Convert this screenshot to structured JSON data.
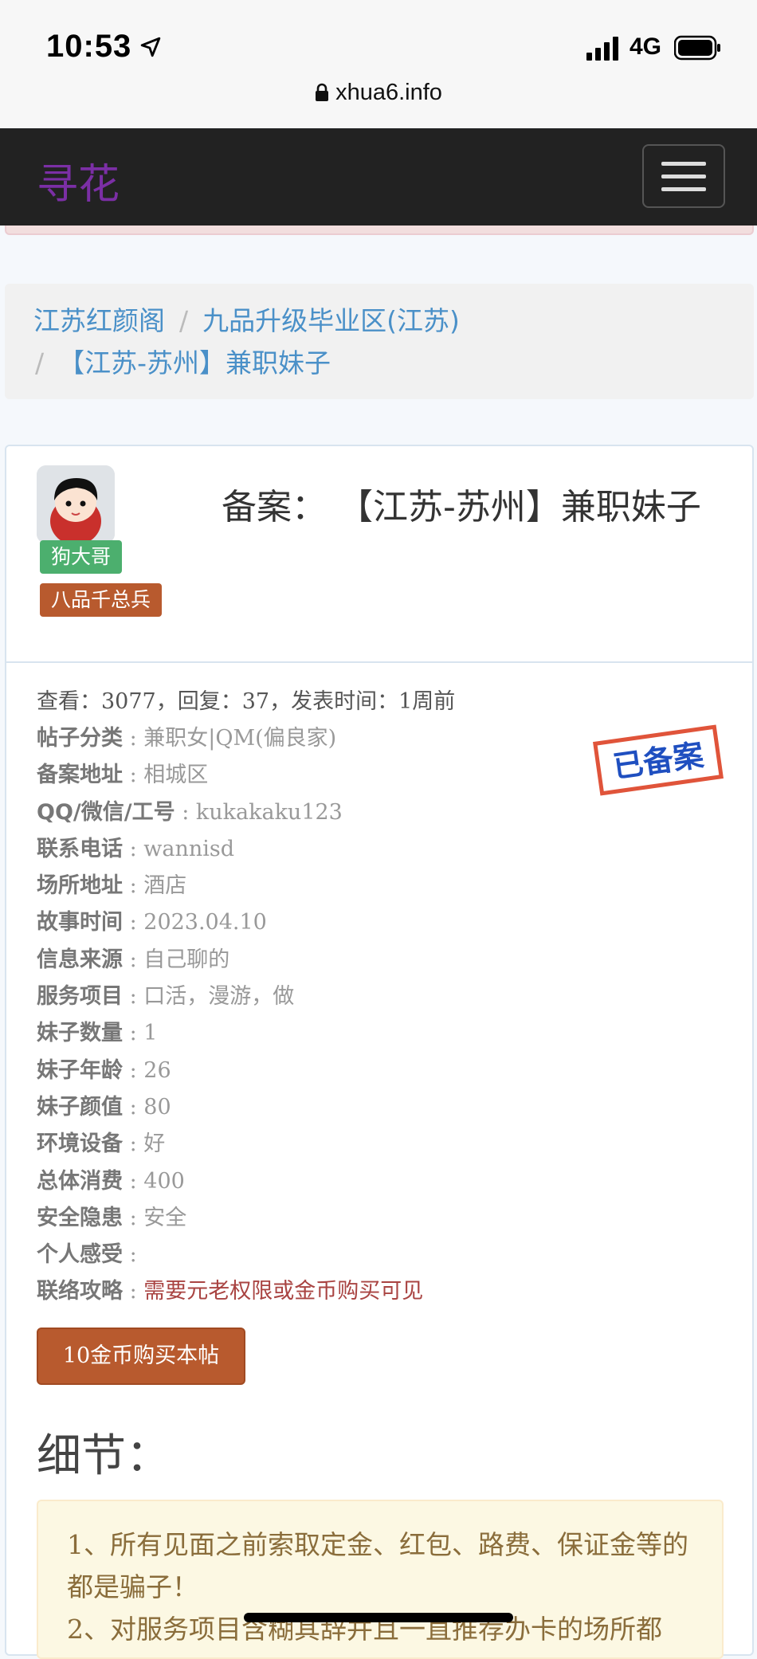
{
  "status_bar": {
    "time": "10:53",
    "network": "4G"
  },
  "browser": {
    "url": "xhua6.info"
  },
  "navbar": {
    "brand": "寻花"
  },
  "breadcrumb": [
    {
      "label": "江苏红颜阁"
    },
    {
      "label": "九品升级毕业区(江苏)"
    },
    {
      "label": "【江苏-苏州】兼职妹子"
    }
  ],
  "post": {
    "title": "备案：  【江苏-苏州】兼职妹子",
    "author": {
      "name": "狗大哥",
      "rank": "八品千总兵"
    },
    "stats": "查看：3077，回复：37，发表时间：1周前",
    "stamp": "已备案",
    "fields": [
      {
        "key": "帖子分类",
        "sep": " : ",
        "value": "兼职女|QM(偏良家)"
      },
      {
        "key": "备案地址",
        "sep": " : ",
        "value": "相城区"
      },
      {
        "key": "QQ/微信/工号",
        "sep": " : ",
        "value": "kukakaku123"
      },
      {
        "key": "联系电话",
        "sep": " : ",
        "value": "wannisd"
      },
      {
        "key": "场所地址",
        "sep": " : ",
        "value": "酒店"
      },
      {
        "key": "故事时间",
        "sep": " : ",
        "value": "2023.04.10"
      },
      {
        "key": "信息来源",
        "sep": " : ",
        "value": "自己聊的"
      },
      {
        "key": "服务项目",
        "sep": " : ",
        "value": "口活，漫游，做"
      },
      {
        "key": "妹子数量",
        "sep": " : ",
        "value": "1"
      },
      {
        "key": "妹子年龄",
        "sep": " : ",
        "value": "26"
      },
      {
        "key": "妹子颜值",
        "sep": " : ",
        "value": "80"
      },
      {
        "key": "环境设备",
        "sep": " : ",
        "value": "好"
      },
      {
        "key": "总体消费",
        "sep": " : ",
        "value": "400"
      },
      {
        "key": "安全隐患",
        "sep": " : ",
        "value": "安全"
      },
      {
        "key": "个人感受",
        "sep": " : ",
        "value": ""
      },
      {
        "key": "联络攻略",
        "sep": " : ",
        "value": "需要元老权限或金币购买可见"
      }
    ],
    "buy_button": "10金币购买本帖",
    "detail_heading": "细节：",
    "notice_lines": [
      "1、所有见面之前索取定金、红包、路费、保证金等的都是骗子！",
      "2、对服务项目含糊其辞并且一直推荐办卡的场所都"
    ]
  },
  "colors": {
    "navbar_bg": "#222222",
    "brand": "#7b2fa5",
    "link": "#4a90c8",
    "rank_badge": "#b85a2e",
    "user_badge": "#4caf6e",
    "warn_text": "#a94442"
  }
}
